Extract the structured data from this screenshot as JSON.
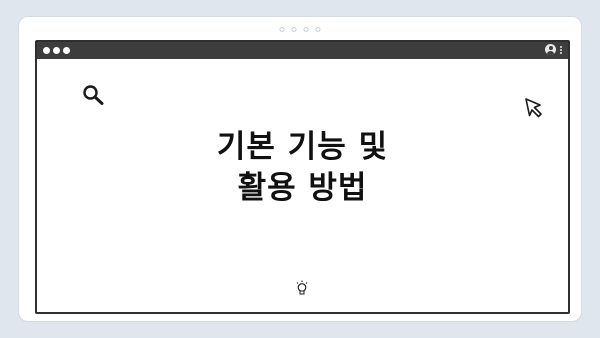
{
  "colors": {
    "page_background": "#dfe6ee",
    "card_background": "#ffffff",
    "titlebar_background": "#3d3d3d",
    "window_border": "#2f2f2f",
    "headline_text": "#111111"
  },
  "window": {
    "titlebar": {
      "controls": [
        "close-dot",
        "minimize-dot",
        "maximize-dot"
      ],
      "right_icons": [
        "profile-icon",
        "kebab-menu-icon"
      ]
    }
  },
  "content": {
    "headline_line1": "기본 기능 및",
    "headline_line2": "활용 방법",
    "icons": [
      "search-icon",
      "cursor-arrow-icon",
      "lightbulb-icon"
    ]
  }
}
